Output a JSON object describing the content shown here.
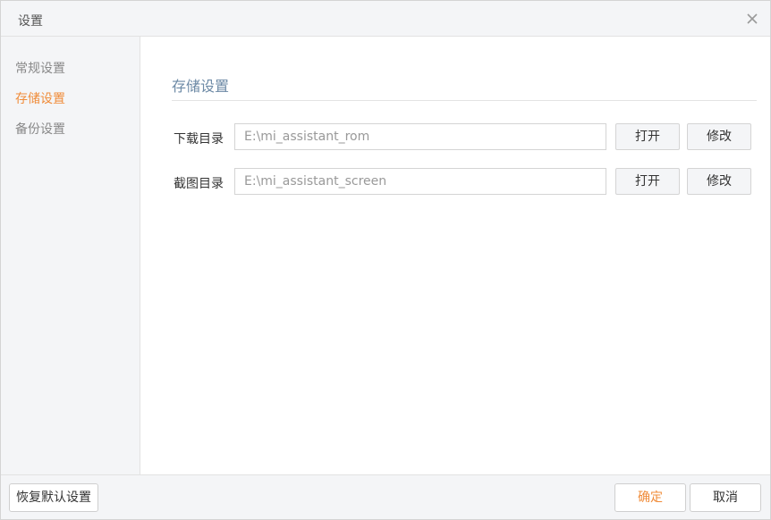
{
  "window": {
    "title": "设置",
    "close_icon": "close-icon"
  },
  "sidebar": {
    "items": [
      {
        "label": "常规设置",
        "active": false
      },
      {
        "label": "存储设置",
        "active": true
      },
      {
        "label": "备份设置",
        "active": false
      }
    ]
  },
  "main": {
    "section_title": "存储设置",
    "rows": [
      {
        "label": "下载目录",
        "value": "E:\\mi_assistant_rom",
        "open_label": "打开",
        "modify_label": "修改"
      },
      {
        "label": "截图目录",
        "value": "E:\\mi_assistant_screen",
        "open_label": "打开",
        "modify_label": "修改"
      }
    ]
  },
  "footer": {
    "restore_label": "恢复默认设置",
    "confirm_label": "确定",
    "cancel_label": "取消"
  },
  "colors": {
    "accent": "#f08c3a",
    "section_title": "#6d8aa6",
    "panel_bg": "#f4f5f7"
  }
}
